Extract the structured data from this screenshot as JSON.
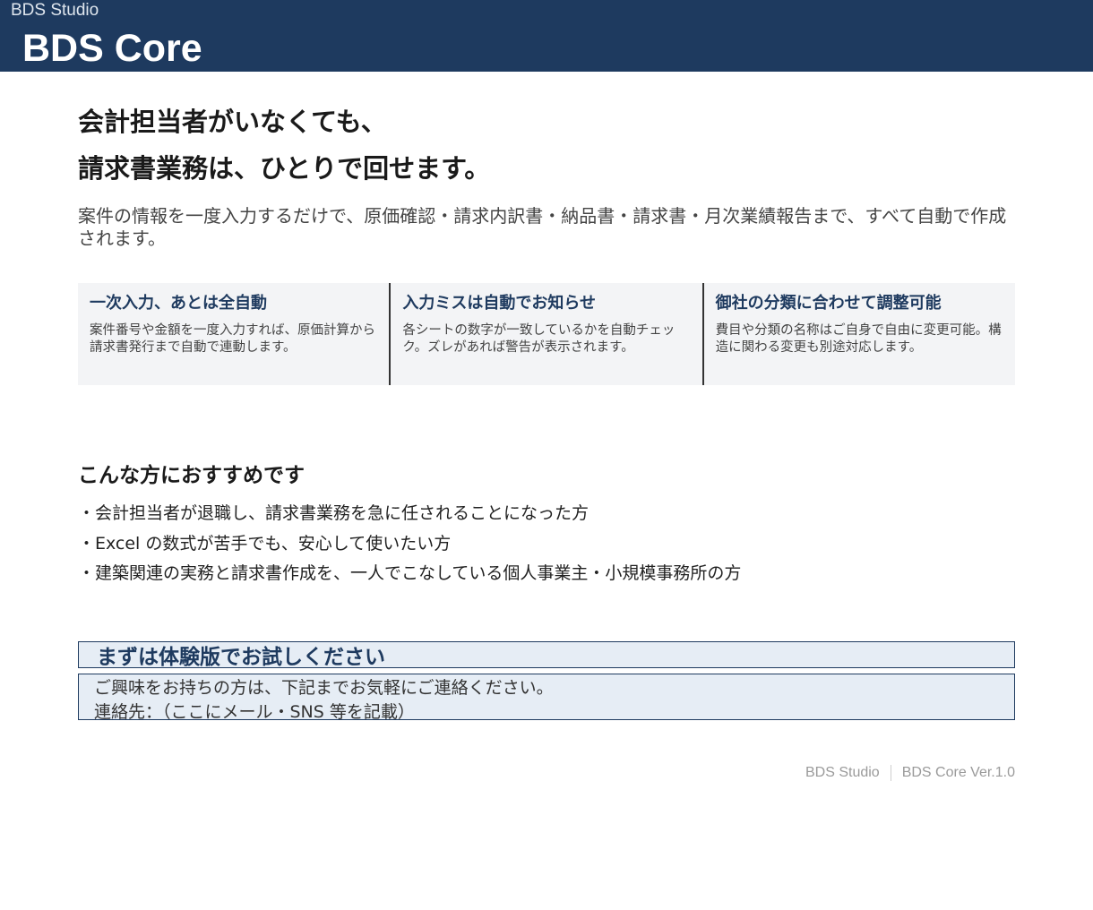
{
  "header": {
    "studio": "BDS Studio",
    "product": "BDS Core"
  },
  "hero": {
    "headline_line1": "会計担当者がいなくても、",
    "headline_line2": "請求書業務は、ひとりで回せます。",
    "lead": "案件の情報を一度入力するだけで、原価確認・請求内訳書・納品書・請求書・月次業績報告まで、すべて自動で作成されます。"
  },
  "features": [
    {
      "title": "一次入力、あとは全自動",
      "text": "案件番号や金額を一度入力すれば、原価計算から請求書発行まで自動で連動します。"
    },
    {
      "title": "入力ミスは自動でお知らせ",
      "text": "各シートの数字が一致しているかを自動チェック。ズレがあれば警告が表示されます。"
    },
    {
      "title": "御社の分類に合わせて調整可能",
      "text": "費目や分類の名称はご自身で自由に変更可能。構造に関わる変更も別途対応します。"
    }
  ],
  "recommend": {
    "title": "こんな方におすすめです",
    "items": [
      "・会計担当者が退職し、請求書業務を急に任されることになった方",
      "・Excel の数式が苦手でも、安心して使いたい方",
      "・建築関連の実務と請求書作成を、一人でこなしている個人事業主・小規模事務所の方"
    ]
  },
  "cta": {
    "title": "まずは体験版でお試しください",
    "line1": "ご興味をお持ちの方は、下記までお気軽にご連絡ください。",
    "line2": "連絡先：（ここにメール・SNS 等を記載）"
  },
  "footer": {
    "studio": "BDS Studio",
    "version": "BDS Core Ver.1.0"
  },
  "colors": {
    "header_bg": "#1e3a5f",
    "accent": "#1e3a5f",
    "panel_bg": "#f3f4f6",
    "cta_bg": "#e6edf5"
  }
}
